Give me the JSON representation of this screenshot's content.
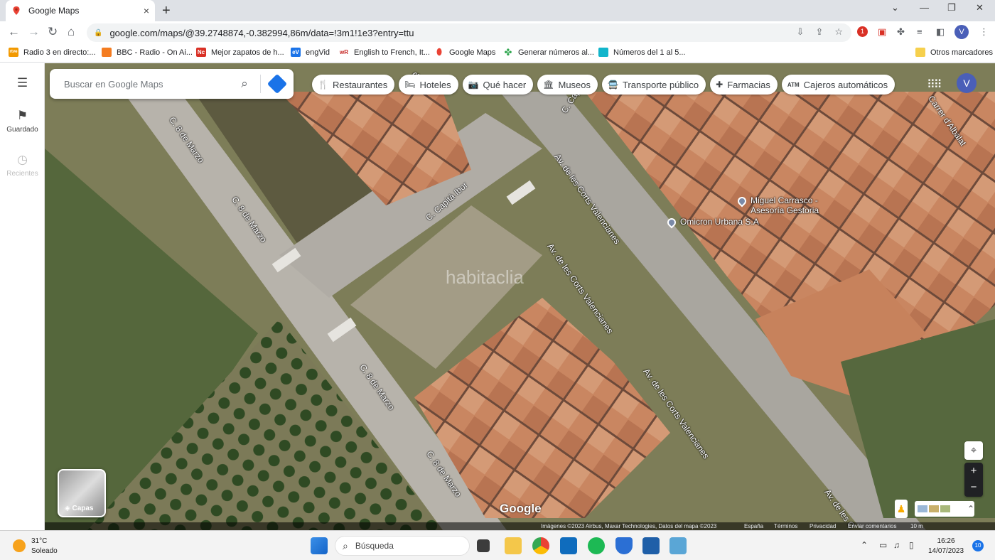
{
  "browser": {
    "tab_title": "Google Maps",
    "tab_close": "×",
    "new_tab": "+",
    "window_controls": [
      "⌄",
      "—",
      "❐",
      "✕"
    ],
    "url": "google.com/maps/@39.2748874,-0.382994,86m/data=!3m1!1e3?entry=ttu",
    "ext_badge": "1",
    "profile_initial": "V",
    "bookmarks": [
      {
        "label": "Radio 3 en directo:...",
        "icon": "rtve",
        "color": "#f29900",
        "icon_text": "rtve"
      },
      {
        "label": "BBC - Radio - On Ai...",
        "icon": "bbc",
        "color": "#f47c20",
        "icon_text": ""
      },
      {
        "label": "Mejor zapatos de h...",
        "icon": "nc",
        "color": "#d93025",
        "icon_text": "Nc"
      },
      {
        "label": "engVid",
        "icon": "engvid",
        "color": "#1a73e8",
        "icon_text": "eV"
      },
      {
        "label": "English to French, It...",
        "icon": "wordreference",
        "color": "#c5221f",
        "icon_text": "wR"
      },
      {
        "label": "Google Maps",
        "icon": "maps",
        "color": "#34a853",
        "icon_text": ""
      },
      {
        "label": "Generar números al...",
        "icon": "clover",
        "color": "#34a853",
        "icon_text": ""
      },
      {
        "label": "Números del 1 al 5...",
        "icon": "grid",
        "color": "#12b5cb",
        "icon_text": ""
      }
    ],
    "other_bookmarks": "Otros marcadores"
  },
  "maps": {
    "search_placeholder": "Buscar en Google Maps",
    "rail": {
      "saved_label": "Guardado",
      "recent_label": "Recientes"
    },
    "chips": [
      {
        "label": "Restaurantes",
        "icon": "🍴"
      },
      {
        "label": "Hoteles",
        "icon": "🛏"
      },
      {
        "label": "Qué hacer",
        "icon": "📷"
      },
      {
        "label": "Museos",
        "icon": "🏛"
      },
      {
        "label": "Transporte público",
        "icon": "🚍"
      },
      {
        "label": "Farmacias",
        "icon": "✚"
      },
      {
        "label": "Cajeros automáticos",
        "icon": "ATM"
      }
    ],
    "avatar_initial": "V",
    "streets": {
      "ocho_marzo": "C. 8 de Marzo",
      "capita_ibor": "C. Capità Ibor",
      "capita_short": "C. Capità",
      "corts": "Av. de les Corts Valencianes",
      "corts_short": "Av. de les C",
      "albalat": "Carrer d'Albalat",
      "partial_top": "de"
    },
    "pois": [
      {
        "name": "Miguel Carrasco -",
        "line2": "Asesoría Gestoria"
      },
      {
        "name": "Omicron Urbana S.A",
        "line2": ""
      }
    ],
    "watermark": "habitaclia",
    "layers_label": "Capas",
    "google_logo": "Google",
    "zoom_in": "+",
    "zoom_out": "−",
    "attribution": {
      "imagery": "Imágenes ©2023 Airbus, Maxar Technologies, Datos del mapa ©2023",
      "country": "España",
      "terms": "Términos",
      "privacy": "Privacidad",
      "feedback": "Enviar comentarios",
      "scale": "10 m"
    }
  },
  "taskbar": {
    "temperature": "31°C",
    "weather": "Soleado",
    "search_label": "Búsqueda",
    "time": "16:26",
    "date": "14/07/2023",
    "notifications": "10"
  },
  "colors": {
    "accent": "#1a73e8",
    "profile": "#4a5fb8"
  }
}
